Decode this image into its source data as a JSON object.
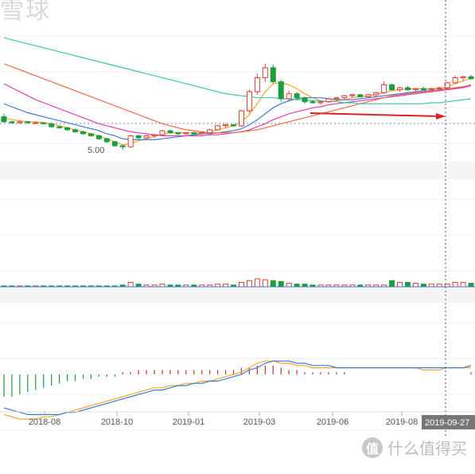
{
  "watermark_top": "雪球",
  "watermark_bottom": {
    "logo": "值",
    "text": "什么值得买"
  },
  "cursor_date_label": "2019-09-27",
  "chart_data": {
    "type": "candlestick",
    "x_ticks": [
      "2018-08",
      "2018-10",
      "2019-01",
      "2019-03",
      "2019-06",
      "2019-08"
    ],
    "price_panel": {
      "min_label": "5.00",
      "reference_line": "dashed horizontal at last close",
      "annotation": "red arrow pointing right along consolidation range",
      "candles": [
        {
          "o": 8.3,
          "h": 8.6,
          "l": 7.7,
          "c": 7.8
        },
        {
          "o": 7.8,
          "h": 7.9,
          "l": 7.6,
          "c": 7.7
        },
        {
          "o": 7.7,
          "h": 7.9,
          "l": 7.6,
          "c": 7.8
        },
        {
          "o": 7.8,
          "h": 7.9,
          "l": 7.6,
          "c": 7.7
        },
        {
          "o": 7.7,
          "h": 7.8,
          "l": 7.6,
          "c": 7.7
        },
        {
          "o": 7.7,
          "h": 7.8,
          "l": 7.5,
          "c": 7.6
        },
        {
          "o": 7.6,
          "h": 7.7,
          "l": 7.2,
          "c": 7.3
        },
        {
          "o": 7.3,
          "h": 7.4,
          "l": 7.1,
          "c": 7.2
        },
        {
          "o": 7.2,
          "h": 7.3,
          "l": 6.9,
          "c": 7.0
        },
        {
          "o": 7.0,
          "h": 7.1,
          "l": 6.7,
          "c": 6.8
        },
        {
          "o": 6.8,
          "h": 6.9,
          "l": 6.5,
          "c": 6.6
        },
        {
          "o": 6.6,
          "h": 6.7,
          "l": 6.3,
          "c": 6.4
        },
        {
          "o": 6.4,
          "h": 6.5,
          "l": 6.0,
          "c": 6.1
        },
        {
          "o": 6.1,
          "h": 6.2,
          "l": 5.7,
          "c": 5.8
        },
        {
          "o": 5.8,
          "h": 5.9,
          "l": 5.3,
          "c": 5.4
        },
        {
          "o": 5.4,
          "h": 5.5,
          "l": 5.0,
          "c": 5.3
        },
        {
          "o": 5.3,
          "h": 6.5,
          "l": 5.2,
          "c": 6.4
        },
        {
          "o": 6.4,
          "h": 6.5,
          "l": 6.0,
          "c": 6.2
        },
        {
          "o": 6.2,
          "h": 6.5,
          "l": 6.1,
          "c": 6.4
        },
        {
          "o": 6.4,
          "h": 6.6,
          "l": 6.2,
          "c": 6.5
        },
        {
          "o": 6.5,
          "h": 7.0,
          "l": 6.4,
          "c": 6.9
        },
        {
          "o": 6.9,
          "h": 7.0,
          "l": 6.6,
          "c": 6.7
        },
        {
          "o": 6.7,
          "h": 6.8,
          "l": 6.5,
          "c": 6.6
        },
        {
          "o": 6.6,
          "h": 6.8,
          "l": 6.5,
          "c": 6.7
        },
        {
          "o": 6.7,
          "h": 6.8,
          "l": 6.5,
          "c": 6.6
        },
        {
          "o": 6.6,
          "h": 6.8,
          "l": 6.5,
          "c": 6.7
        },
        {
          "o": 6.7,
          "h": 7.1,
          "l": 6.6,
          "c": 7.0
        },
        {
          "o": 7.0,
          "h": 7.5,
          "l": 6.9,
          "c": 7.4
        },
        {
          "o": 7.4,
          "h": 7.6,
          "l": 7.2,
          "c": 7.5
        },
        {
          "o": 7.5,
          "h": 7.6,
          "l": 7.3,
          "c": 7.4
        },
        {
          "o": 7.4,
          "h": 9.0,
          "l": 7.3,
          "c": 8.9
        },
        {
          "o": 8.9,
          "h": 11.0,
          "l": 8.7,
          "c": 10.8
        },
        {
          "o": 10.8,
          "h": 12.6,
          "l": 10.5,
          "c": 12.2
        },
        {
          "o": 12.2,
          "h": 13.6,
          "l": 11.8,
          "c": 13.2
        },
        {
          "o": 13.2,
          "h": 13.5,
          "l": 11.6,
          "c": 11.8
        },
        {
          "o": 11.8,
          "h": 12.0,
          "l": 9.8,
          "c": 10.1
        },
        {
          "o": 10.1,
          "h": 10.9,
          "l": 9.9,
          "c": 10.6
        },
        {
          "o": 10.6,
          "h": 10.8,
          "l": 10.0,
          "c": 10.2
        },
        {
          "o": 10.2,
          "h": 10.3,
          "l": 9.6,
          "c": 9.8
        },
        {
          "o": 9.8,
          "h": 10.0,
          "l": 9.6,
          "c": 9.7
        },
        {
          "o": 9.7,
          "h": 9.9,
          "l": 9.5,
          "c": 9.8
        },
        {
          "o": 9.8,
          "h": 10.2,
          "l": 9.7,
          "c": 10.1
        },
        {
          "o": 10.1,
          "h": 10.3,
          "l": 9.9,
          "c": 10.2
        },
        {
          "o": 10.2,
          "h": 10.5,
          "l": 10.0,
          "c": 10.4
        },
        {
          "o": 10.4,
          "h": 10.6,
          "l": 10.2,
          "c": 10.5
        },
        {
          "o": 10.5,
          "h": 10.6,
          "l": 10.2,
          "c": 10.3
        },
        {
          "o": 10.3,
          "h": 10.6,
          "l": 10.2,
          "c": 10.5
        },
        {
          "o": 10.5,
          "h": 10.8,
          "l": 10.3,
          "c": 10.7
        },
        {
          "o": 10.7,
          "h": 11.8,
          "l": 10.6,
          "c": 11.5
        },
        {
          "o": 11.5,
          "h": 11.6,
          "l": 10.9,
          "c": 11.0
        },
        {
          "o": 11.0,
          "h": 11.3,
          "l": 10.8,
          "c": 11.2
        },
        {
          "o": 11.2,
          "h": 11.4,
          "l": 10.9,
          "c": 11.0
        },
        {
          "o": 11.0,
          "h": 11.2,
          "l": 10.8,
          "c": 11.1
        },
        {
          "o": 11.1,
          "h": 11.3,
          "l": 10.9,
          "c": 11.0
        },
        {
          "o": 11.0,
          "h": 11.2,
          "l": 10.8,
          "c": 11.1
        },
        {
          "o": 11.1,
          "h": 11.3,
          "l": 10.9,
          "c": 11.2
        },
        {
          "o": 11.2,
          "h": 11.8,
          "l": 11.1,
          "c": 11.7
        },
        {
          "o": 11.7,
          "h": 12.4,
          "l": 11.6,
          "c": 12.2
        },
        {
          "o": 12.2,
          "h": 12.4,
          "l": 11.9,
          "c": 12.3
        },
        {
          "o": 12.3,
          "h": 12.5,
          "l": 12.0,
          "c": 12.1
        }
      ],
      "moving_averages": [
        {
          "color": "#f5a623",
          "values": [
            8.2,
            8.0,
            7.9,
            7.8,
            7.8,
            7.7,
            7.6,
            7.4,
            7.2,
            7.0,
            6.8,
            6.6,
            6.4,
            6.1,
            5.8,
            5.5,
            5.6,
            5.9,
            6.1,
            6.3,
            6.6,
            6.7,
            6.7,
            6.7,
            6.7,
            6.7,
            6.8,
            7.0,
            7.2,
            7.4,
            7.8,
            8.5,
            9.6,
            10.8,
            11.6,
            11.7,
            11.5,
            11.1,
            10.6,
            10.2,
            9.9,
            9.8,
            9.9,
            10.0,
            10.2,
            10.3,
            10.4,
            10.5,
            10.7,
            10.9,
            11.0,
            11.1,
            11.1,
            11.1,
            11.1,
            11.1,
            11.3,
            11.6,
            11.9,
            12.1
          ]
        },
        {
          "color": "#3a7bd5",
          "values": [
            9.6,
            9.3,
            9.0,
            8.7,
            8.5,
            8.3,
            8.1,
            7.9,
            7.7,
            7.5,
            7.3,
            7.1,
            6.9,
            6.6,
            6.4,
            6.1,
            6.0,
            6.0,
            6.0,
            6.0,
            6.1,
            6.2,
            6.3,
            6.4,
            6.5,
            6.6,
            6.6,
            6.7,
            6.8,
            6.9,
            7.1,
            7.5,
            8.0,
            8.6,
            9.2,
            9.6,
            9.9,
            10.1,
            10.2,
            10.2,
            10.2,
            10.1,
            10.0,
            10.0,
            10.0,
            10.1,
            10.2,
            10.3,
            10.4,
            10.5,
            10.6,
            10.7,
            10.8,
            10.9,
            10.9,
            11.0,
            11.1,
            11.2,
            11.3,
            11.5
          ]
        },
        {
          "color": "#e040b0",
          "values": [
            11.6,
            11.2,
            10.8,
            10.4,
            10.0,
            9.7,
            9.4,
            9.1,
            8.8,
            8.5,
            8.2,
            7.9,
            7.6,
            7.4,
            7.2,
            7.0,
            6.8,
            6.7,
            6.6,
            6.5,
            6.4,
            6.4,
            6.4,
            6.4,
            6.4,
            6.4,
            6.5,
            6.5,
            6.6,
            6.7,
            6.8,
            7.0,
            7.3,
            7.6,
            8.0,
            8.3,
            8.6,
            8.8,
            9.0,
            9.2,
            9.3,
            9.5,
            9.6,
            9.7,
            9.8,
            9.9,
            10.0,
            10.1,
            10.2,
            10.3,
            10.4,
            10.5,
            10.6,
            10.7,
            10.8,
            10.9,
            11.0,
            11.1,
            11.2,
            11.4
          ]
        },
        {
          "color": "#ef6a45",
          "values": [
            13.6,
            13.3,
            13.0,
            12.7,
            12.4,
            12.1,
            11.8,
            11.5,
            11.2,
            10.9,
            10.6,
            10.3,
            10.0,
            9.7,
            9.4,
            9.1,
            8.8,
            8.5,
            8.2,
            7.9,
            7.6,
            7.4,
            7.2,
            7.0,
            6.9,
            6.8,
            6.7,
            6.7,
            6.7,
            6.7,
            6.8,
            6.9,
            7.0,
            7.2,
            7.4,
            7.6,
            7.8,
            8.0,
            8.2,
            8.4,
            8.6,
            8.8,
            9.0,
            9.2,
            9.4,
            9.6,
            9.8,
            10.0,
            10.2,
            10.4,
            10.5,
            10.6,
            10.7,
            10.8,
            10.9,
            11.0,
            11.1,
            11.2,
            11.3,
            11.5
          ]
        },
        {
          "color": "#3cc9a0",
          "values": [
            16.2,
            16.0,
            15.8,
            15.6,
            15.4,
            15.2,
            15.0,
            14.8,
            14.6,
            14.4,
            14.2,
            14.0,
            13.8,
            13.6,
            13.4,
            13.2,
            13.0,
            12.8,
            12.6,
            12.4,
            12.2,
            12.0,
            11.8,
            11.6,
            11.4,
            11.2,
            11.0,
            10.8,
            10.6,
            10.5,
            10.4,
            10.3,
            10.2,
            10.2,
            10.2,
            10.1,
            10.1,
            10.0,
            10.0,
            9.9,
            9.9,
            9.8,
            9.8,
            9.7,
            9.7,
            9.6,
            9.6,
            9.6,
            9.6,
            9.6,
            9.6,
            9.6,
            9.6,
            9.6,
            9.7,
            9.7,
            9.8,
            9.9,
            10.0,
            10.1
          ]
        }
      ]
    },
    "volume_panel": {
      "values": [
        1,
        1,
        1,
        1,
        1,
        1,
        1,
        1,
        1,
        1,
        1,
        1,
        1,
        1,
        1,
        2,
        5,
        3,
        2,
        2,
        3,
        2,
        2,
        2,
        2,
        2,
        2,
        3,
        3,
        2,
        5,
        7,
        9,
        8,
        7,
        6,
        4,
        3,
        3,
        2,
        2,
        2,
        2,
        2,
        2,
        2,
        2,
        2,
        2,
        7,
        5,
        5,
        4,
        3,
        3,
        3,
        3,
        5,
        5,
        4
      ]
    },
    "macd_panel": {
      "hist": [
        -10,
        -10,
        -9,
        -8,
        -7,
        -6,
        -5,
        -4,
        -3,
        -3,
        -2,
        -2,
        -1,
        -1,
        -1,
        1,
        1,
        2,
        2,
        2,
        2,
        2,
        2,
        2,
        2,
        2,
        2,
        2,
        2,
        2,
        3,
        3,
        4,
        4,
        4,
        3,
        2,
        2,
        1,
        1,
        1,
        1,
        1,
        1,
        0,
        0,
        0,
        0,
        0,
        0,
        0,
        0,
        0,
        0,
        0,
        0,
        0,
        0,
        0,
        1
      ],
      "dif": [
        -18,
        -19,
        -20,
        -20,
        -20,
        -19,
        -19,
        -18,
        -17,
        -16,
        -15,
        -14,
        -13,
        -12,
        -11,
        -10,
        -9,
        -8,
        -7,
        -6,
        -6,
        -5,
        -5,
        -4,
        -4,
        -3,
        -3,
        -2,
        -1,
        0,
        1,
        3,
        5,
        6,
        6,
        5,
        5,
        4,
        4,
        3,
        3,
        3,
        3,
        3,
        3,
        3,
        3,
        3,
        3,
        3,
        3,
        3,
        3,
        2,
        2,
        2,
        3,
        3,
        3,
        3
      ],
      "dea": [
        -15,
        -16,
        -17,
        -18,
        -18,
        -18,
        -18,
        -18,
        -17,
        -17,
        -16,
        -15,
        -14,
        -13,
        -12,
        -11,
        -10,
        -9,
        -8,
        -7,
        -7,
        -6,
        -5,
        -5,
        -4,
        -4,
        -3,
        -3,
        -2,
        -1,
        0,
        2,
        3,
        5,
        6,
        6,
        6,
        5,
        5,
        4,
        4,
        4,
        3,
        3,
        3,
        3,
        3,
        3,
        3,
        3,
        3,
        3,
        3,
        3,
        3,
        3,
        3,
        3,
        3,
        4
      ]
    }
  }
}
